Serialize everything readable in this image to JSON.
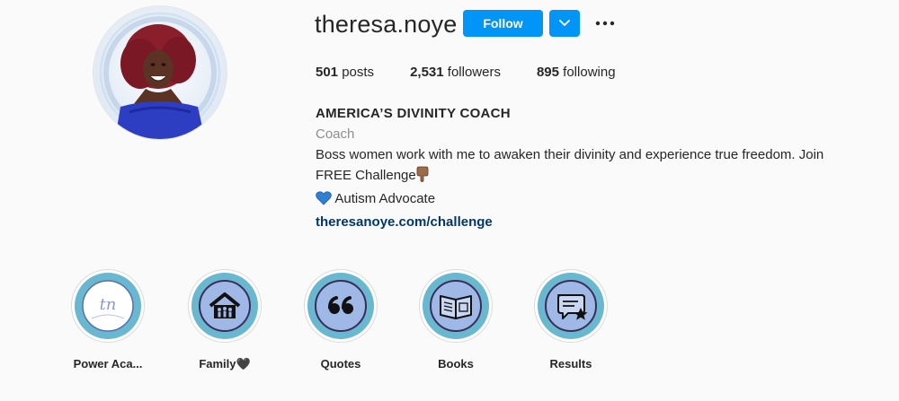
{
  "profile": {
    "username": "theresa.noye",
    "follow_label": "Follow",
    "stats": {
      "posts_count": "501",
      "posts_label": "posts",
      "followers_count": "2,531",
      "followers_label": "followers",
      "following_count": "895",
      "following_label": "following"
    }
  },
  "bio": {
    "name": "AMERICA’S DIVINITY COACH",
    "category": "Coach",
    "line1": "Boss women work with me to awaken their divinity and experience true freedom. Join",
    "line2": "FREE Challenge",
    "line3": "Autism Advocate",
    "link": "theresanoye.com/challenge"
  },
  "highlights": [
    {
      "label": "Power Aca...",
      "icon": "logo-tn-icon"
    },
    {
      "label": "Family🖤",
      "icon": "house-family-icon"
    },
    {
      "label": "Quotes",
      "icon": "quote-marks-icon"
    },
    {
      "label": "Books",
      "icon": "open-book-icon"
    },
    {
      "label": "Results",
      "icon": "chat-star-icon"
    }
  ],
  "colors": {
    "follow_button": "#0095f6",
    "highlight_ring": "#6ab7d0",
    "highlight_border": "#3b2d5a",
    "link": "#00376b"
  }
}
